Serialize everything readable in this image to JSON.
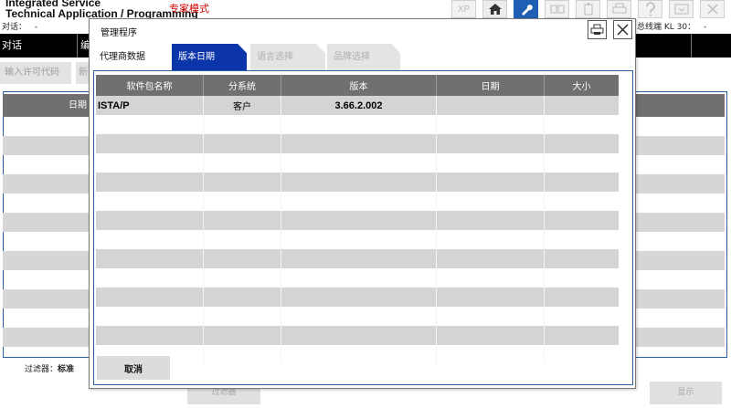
{
  "app": {
    "title_line1": "Integrated Service",
    "title_line2": "Technical Application / Programming",
    "mode": "专家模式"
  },
  "toolbar": {
    "xp_label": "XP",
    "icons": [
      "home-icon",
      "wrench-icon",
      "transfer-icon",
      "device-icon",
      "printer-icon",
      "help-icon",
      "window-icon",
      "close-icon"
    ]
  },
  "info_bar": {
    "dialog_label": "对话：",
    "dialog_value": "-",
    "kl30_label": "总线端 KL 30：",
    "kl30_value": "-"
  },
  "bg_tabs": [
    {
      "label": "对话"
    },
    {
      "label": "编"
    }
  ],
  "bg_buttons": {
    "license": "输入许可代码",
    "second": "新"
  },
  "bg_table": {
    "header_date": "日期"
  },
  "filter": {
    "label": "过滤器：",
    "value": "标准"
  },
  "bottom_buttons": {
    "filter": "过滤器",
    "display": "显示"
  },
  "modal": {
    "title": "管理程序",
    "tabs": [
      {
        "label": "代理商数据",
        "state": "plain"
      },
      {
        "label": "版本日期",
        "state": "active"
      },
      {
        "label": "语言选择",
        "state": "disabled"
      },
      {
        "label": "品牌选择",
        "state": "disabled"
      }
    ],
    "columns": [
      "软件包名称",
      "分系统",
      "版本",
      "日期",
      "大小"
    ],
    "rows": [
      {
        "package": "ISTA/P",
        "subsystem": "客户",
        "version": "3.66.2.002",
        "date": "",
        "size": ""
      }
    ],
    "cancel_label": "取消"
  },
  "colors": {
    "accent_blue": "#0b35a8",
    "header_gray": "#707070",
    "stripe_gray": "#d4d4d4",
    "mode_red": "#d40000"
  }
}
